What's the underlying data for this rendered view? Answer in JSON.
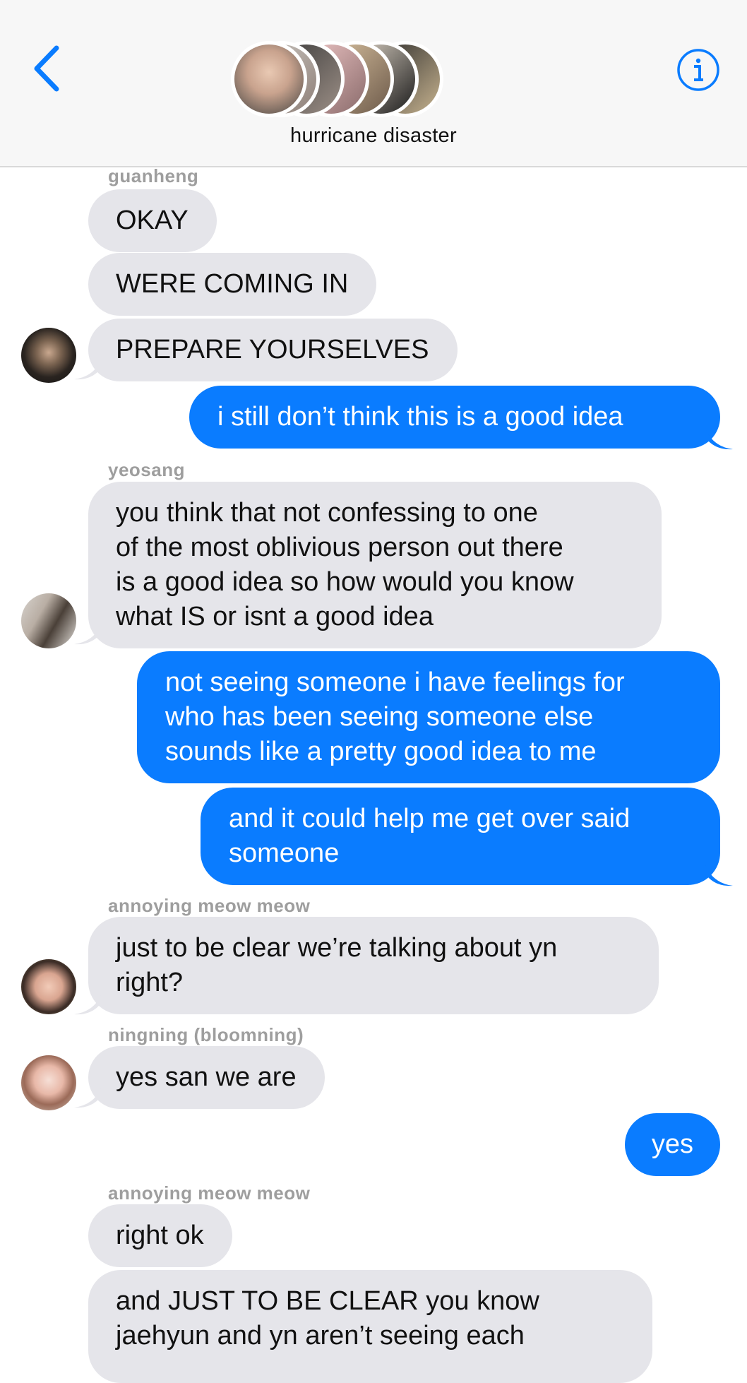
{
  "header": {
    "title": "hurricane disaster",
    "back_icon": "chevron-left-icon",
    "info_icon": "info-circle-icon",
    "accent": "#0a7cff"
  },
  "messages": [
    {
      "sender": "guanheng"
    },
    {
      "text": "OKAY"
    },
    {
      "text": "WERE COMING IN"
    },
    {
      "text": "PREPARE YOURSELVES"
    },
    {
      "text": "i still don’t think this is a good idea"
    },
    {
      "sender": "yeosang"
    },
    {
      "text": "you think that not confessing to one\nof the most oblivious person out there\nis a good idea so how would you know\nwhat IS or isnt a good idea"
    },
    {
      "text": "not seeing someone i have feelings for\nwho has been seeing someone else\nsounds like a pretty good idea to me"
    },
    {
      "text": "and it could help me get over said\nsomeone"
    },
    {
      "sender": "annoying meow meow"
    },
    {
      "text": "just to be clear we’re talking about yn\nright?"
    },
    {
      "sender": "ningning (bloomning)"
    },
    {
      "text": "yes san we are"
    },
    {
      "text": "yes"
    },
    {
      "sender": "annoying meow meow"
    },
    {
      "text": "right ok"
    },
    {
      "text": "and JUST TO BE CLEAR you know\njaehyun and yn aren’t seeing each"
    }
  ],
  "colors": {
    "outgoing_bubble": "#0a7cff",
    "incoming_bubble": "#e5e5ea",
    "header_bg": "#f7f7f7",
    "sender_name": "#9e9e9e"
  }
}
